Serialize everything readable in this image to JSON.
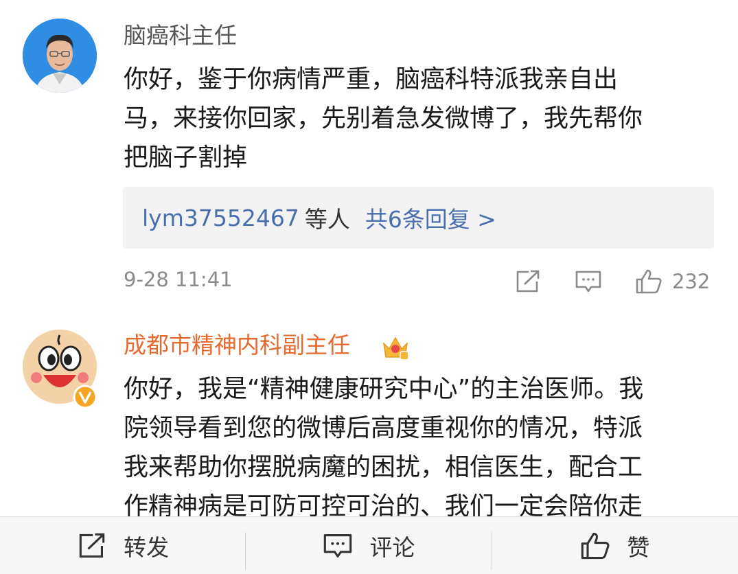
{
  "comments": [
    {
      "username": "脑癌科主任",
      "lines": [
        "你好，鉴于你病情严重，脑癌科特派我亲自出",
        "马，来接你回家，先别着急发微博了，我先帮你",
        "把脑子割掉"
      ],
      "replies": {
        "users": "lym37552467",
        "suffix": "等人",
        "link": "共6条回复 >"
      },
      "time": "9-28 11:41",
      "likes": "232"
    },
    {
      "username": "成都市精神内科副主任",
      "username_color": "#e8692e",
      "lines": [
        "你好，我是“精神健康研究中心”的主治医师。我",
        "院领导看到您的微博后高度重视你的情况，特派",
        "我来帮助你摆脱病魔的困扰，相信医生，配合工",
        "作精神病是可防可控可治的、我们一定会陪你走"
      ]
    }
  ],
  "bottom_bar": {
    "repost": "转发",
    "comment": "评论",
    "like": "赞"
  },
  "icons": {
    "share": "share-icon",
    "comment": "comment-icon",
    "like": "thumbs-up-icon",
    "badge": "crown-badge-icon",
    "verified": "verified-v-icon"
  }
}
